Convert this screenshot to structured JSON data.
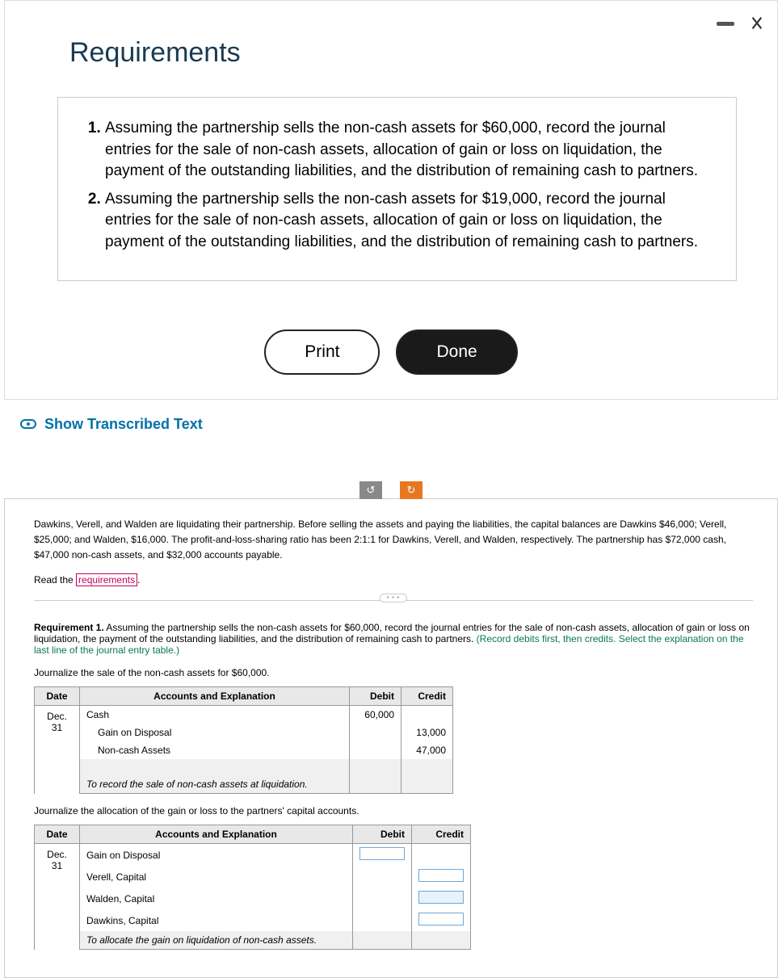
{
  "modal": {
    "title": "Requirements",
    "items": [
      "Assuming the partnership sells the non-cash assets for $60,000, record the journal entries for the sale of non-cash assets, allocation of gain or loss on liquidation, the payment of the outstanding liabilities, and the distribution of remaining cash to partners.",
      "Assuming the partnership sells the non-cash assets for $19,000, record the journal entries for the sale of non-cash assets, allocation of gain or loss on liquidation, the payment of the outstanding liabilities, and the distribution of remaining cash to partners."
    ],
    "print": "Print",
    "done": "Done"
  },
  "transcribed": "Show Transcribed Text",
  "work": {
    "intro": "Dawkins, Verell, and Walden are liquidating their partnership. Before selling the assets and paying the liabilities, the capital balances are Dawkins $46,000; Verell, $25,000; and Walden, $16,000. The profit-and-loss-sharing ratio has been 2:1:1 for Dawkins, Verell, and Walden, respectively. The partnership has $72,000 cash, $47,000 non-cash assets, and $32,000 accounts payable.",
    "read_the": "Read the ",
    "req_link": "requirements",
    "req1_label": "Requirement 1.",
    "req1_text": " Assuming the partnership sells the non-cash assets for $60,000, record the journal entries for the sale of non-cash assets, allocation of gain or loss on liquidation, the payment of the outstanding liabilities, and the distribution of remaining cash to partners. ",
    "req1_instr": "(Record debits first, then credits. Select the explanation on the last line of the journal entry table.)",
    "prompt1": "Journalize the sale of the non-cash assets for $60,000.",
    "prompt2": "Journalize the allocation of the gain or loss to the partners' capital accounts.",
    "headers": {
      "date": "Date",
      "acct": "Accounts and Explanation",
      "debit": "Debit",
      "credit": "Credit"
    },
    "t1": {
      "date": "Dec. 31",
      "r1": {
        "acct": "Cash",
        "debit": "60,000",
        "credit": ""
      },
      "r2": {
        "acct": "Gain on Disposal",
        "debit": "",
        "credit": "13,000"
      },
      "r3": {
        "acct": "Non-cash Assets",
        "debit": "",
        "credit": "47,000"
      },
      "explain": "To record the sale of non-cash assets at liquidation."
    },
    "t2": {
      "date": "Dec. 31",
      "r1": "Gain on Disposal",
      "r2": "Verell, Capital",
      "r3": "Walden, Capital",
      "r4": "Dawkins, Capital",
      "explain": "To allocate the gain on liquidation of non-cash assets."
    }
  }
}
